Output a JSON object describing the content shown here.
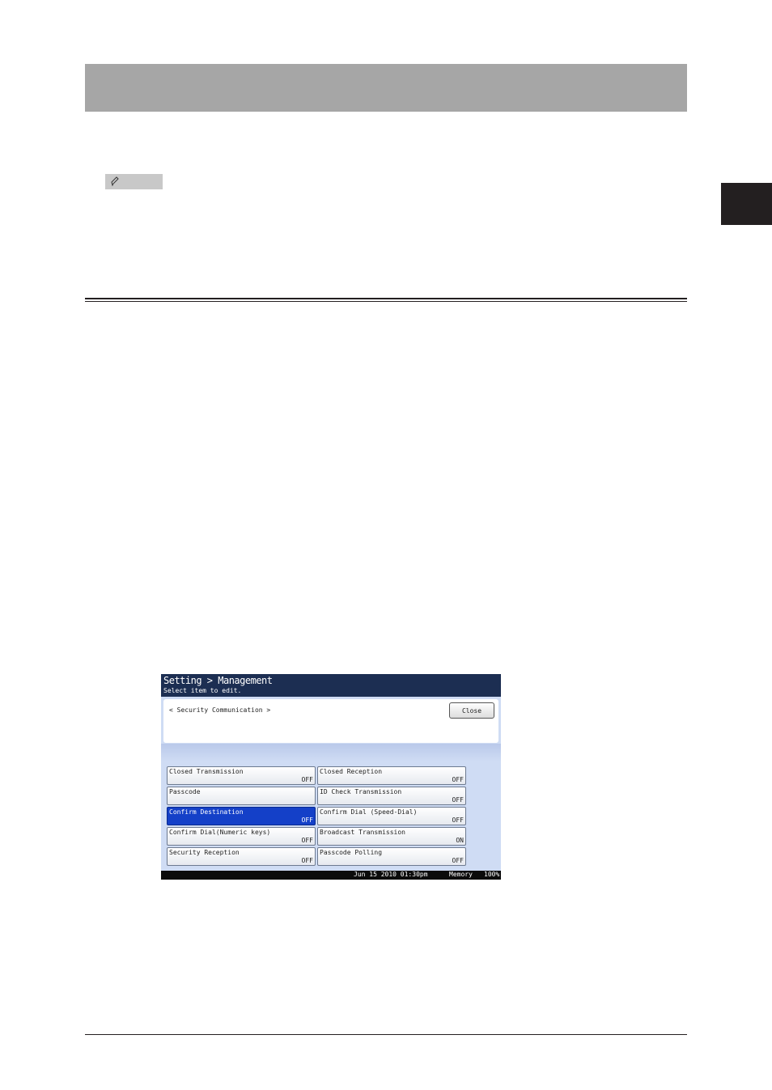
{
  "screen": {
    "title": "Setting > Management",
    "subtitle": "Select item to edit.",
    "panel_label": "< Security Communication >",
    "close_label": "Close",
    "options": [
      {
        "name": "Closed Transmission",
        "value": "OFF"
      },
      {
        "name": "Closed Reception",
        "value": "OFF"
      },
      {
        "name": "Passcode",
        "value": ""
      },
      {
        "name": "ID Check Transmission",
        "value": "OFF"
      },
      {
        "name": "Confirm Destination",
        "value": "OFF",
        "selected": true
      },
      {
        "name": "Confirm Dial (Speed-Dial)",
        "value": "OFF"
      },
      {
        "name": "Confirm Dial(Numeric keys)",
        "value": "OFF"
      },
      {
        "name": "Broadcast Transmission",
        "value": "ON"
      },
      {
        "name": "Security Reception",
        "value": "OFF"
      },
      {
        "name": "Passcode Polling",
        "value": "OFF"
      }
    ],
    "status": {
      "date": "Jun 15 2010 01:30pm",
      "memory_label": "Memory",
      "memory_value": "100%"
    }
  },
  "colors": {
    "header_bar": "#a6a6a6",
    "title_bar": "#1c2e52",
    "selected": "#1440c8",
    "screen_bg": "#cfdcf4"
  },
  "icons": [
    "note-pencil-icon"
  ]
}
